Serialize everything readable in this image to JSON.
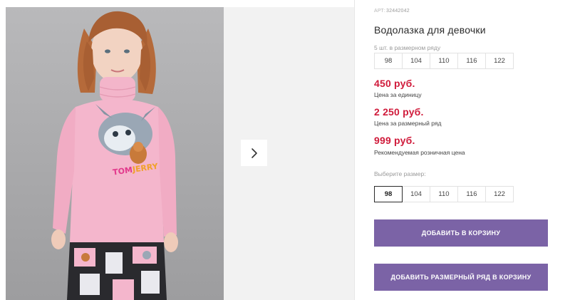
{
  "product": {
    "sku_label": "АРТ:",
    "sku": "32442042",
    "title": "Водолазка для девочки",
    "row_caption": "5 шт. в размерном ряду",
    "row_sizes": [
      "98",
      "104",
      "110",
      "116",
      "122"
    ]
  },
  "prices": [
    {
      "value": "450 руб.",
      "label": "Цена за единицу"
    },
    {
      "value": "2 250 руб.",
      "label": "Цена за размерный ряд"
    },
    {
      "value": "999 руб.",
      "label": "Рекомендуемая розничная цена"
    }
  ],
  "size_select": {
    "label": "Выберите размер:",
    "options": [
      "98",
      "104",
      "110",
      "116",
      "122"
    ],
    "selected": "98"
  },
  "buttons": {
    "add_to_cart": "ДОБАВИТЬ В КОРЗИНУ",
    "add_row_to_cart": "ДОБАВИТЬ РАЗМЕРНЫЙ РЯД В КОРЗИНУ"
  },
  "gallery": {
    "next_icon": "chevron-right-icon",
    "print_text": "TOM and JERRY"
  },
  "colors": {
    "price": "#d01b3b",
    "button": "#7b63a6",
    "button_text": "#ffffff",
    "shirt": "#f4b6cc"
  }
}
